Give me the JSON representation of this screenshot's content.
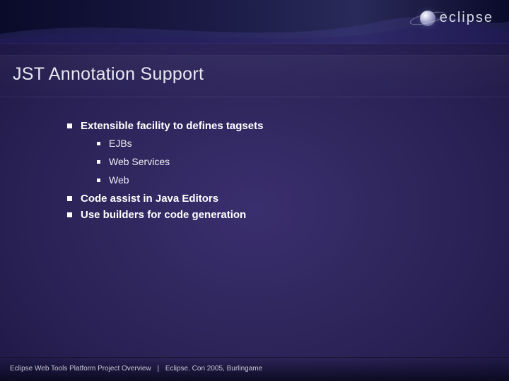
{
  "brand": {
    "name": "eclipse"
  },
  "slide": {
    "title": "JST Annotation Support",
    "bullets": [
      {
        "text": "Extensible facility to defines tagsets",
        "children": [
          {
            "text": "EJBs"
          },
          {
            "text": "Web Services"
          },
          {
            "text": "Web"
          }
        ]
      },
      {
        "text": "Code assist in Java Editors"
      },
      {
        "text": "Use builders for code generation"
      }
    ]
  },
  "footer": {
    "left": "Eclipse Web Tools Platform Project Overview",
    "separator": "|",
    "right": "Eclipse. Con 2005, Burlingame"
  }
}
